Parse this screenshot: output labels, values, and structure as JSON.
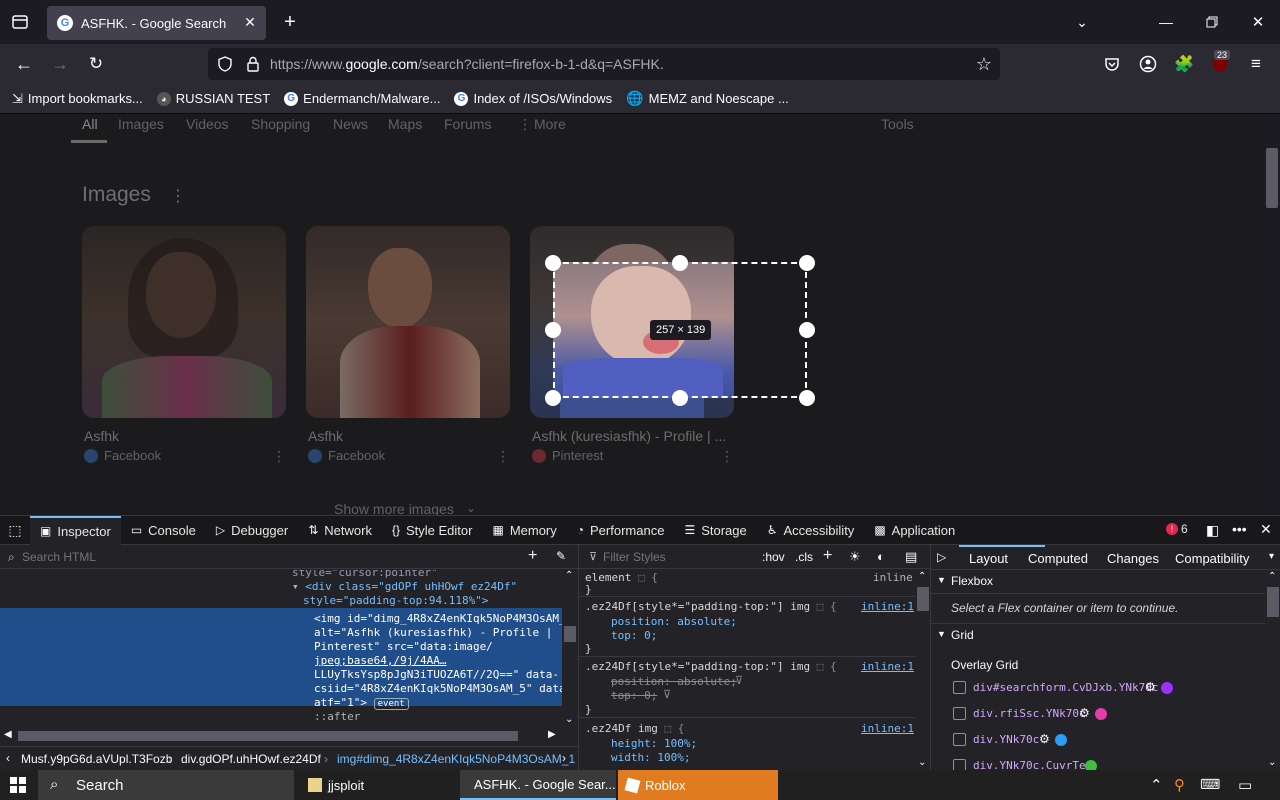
{
  "browser": {
    "tab_title": "ASFHK. - Google Search",
    "new_tab": "+",
    "url_prefix": "https://www.",
    "url_domain": "google.com",
    "url_rest": "/search?client=firefox-b-1-d&q=ASFHK.",
    "extension_badge": "23"
  },
  "bookmarks": [
    {
      "label": "Import bookmarks..."
    },
    {
      "label": "RUSSIAN TEST"
    },
    {
      "label": "Endermanch/Malware..."
    },
    {
      "label": "Index of /ISOs/Windows"
    },
    {
      "label": "MEMZ and Noescape ..."
    }
  ],
  "google": {
    "tabs": [
      "All",
      "Images",
      "Videos",
      "Shopping",
      "News",
      "Maps",
      "Forums",
      "More"
    ],
    "tools": "Tools",
    "section_title": "Images",
    "cards": [
      {
        "title": "Asfhk",
        "source": "Facebook"
      },
      {
        "title": "Asfhk",
        "source": "Facebook"
      },
      {
        "title": "Asfhk (kuresiasfhk) - Profile | ...",
        "source": "Pinterest"
      }
    ],
    "show_more": "Show more images",
    "size_tooltip": "257 × 139"
  },
  "devtools": {
    "tabs": [
      "Inspector",
      "Console",
      "Debugger",
      "Network",
      "Style Editor",
      "Memory",
      "Performance",
      "Storage",
      "Accessibility",
      "Application"
    ],
    "error_count": "6",
    "search_placeholder": "Search HTML",
    "filter_placeholder": "Filter Styles",
    "hov": ":hov",
    "cls": ".cls",
    "html_lines": {
      "line0": "style=\"cursor:pointer\"",
      "line1": "<div class=\"gdOPf uhHOwf ez24Df\"",
      "line2": "style=\"padding-top:94.118%\">",
      "line3": "<img id=\"dimg_4R8xZ4enKIqk5NoP4M3OsAM_1\"",
      "line4": "alt=\"Asfhk (kuresiasfhk) - Profile |",
      "line5": "Pinterest\" src=\"data:image/",
      "line6": "jpeg;base64,/9j/4AA…",
      "line7": "LLUyTksYsp8pJgN3iTUOZA6T//2Q==\" data-",
      "line8": "csiid=\"4R8xZ4enKIqk5NoP4M3OsAM_5\" data-",
      "line9": "atf=\"1\">",
      "event": "event",
      "after": "::after"
    },
    "breadcrumbs": [
      "Musf.y9pG6d.aVUpl.T3Fozb",
      "div.gdOPf.uhHOwf.ez24Df",
      "img#dimg_4R8xZ4enKIqk5NoP4M3OsAM_1"
    ],
    "rules": {
      "r1_selector": "element",
      "r1_source": "inline",
      "r2_selector": ".ez24Df[style*=\"padding-top:\"] img",
      "r2_source": "inline:1",
      "r2_p1": "position: absolute;",
      "r2_p2": "top: 0;",
      "r3_selector": ".ez24Df[style*=\"padding-top:\"] img",
      "r3_source": "inline:1",
      "r3_p1": "position: absolute;",
      "r3_p2": "top: 0;",
      "r4_selector": ".ez24Df img",
      "r4_source": "inline:1",
      "r4_p1": "height: 100%;",
      "r4_p2": "width: 100%;"
    },
    "layout_tabs": [
      "Layout",
      "Computed",
      "Changes",
      "Compatibility"
    ],
    "flexbox_title": "Flexbox",
    "flexbox_hint": "Select a Flex container or item to continue.",
    "grid_title": "Grid",
    "overlay_grid": "Overlay Grid",
    "grid_items": [
      {
        "label": "div#searchform.CvDJxb.YNk70c",
        "color": "#9b30ff"
      },
      {
        "label": "div.rfiSsc.YNk70c",
        "color": "#e63ca8"
      },
      {
        "label": "div.YNk70c",
        "color": "#2a9df4"
      },
      {
        "label": "div.YNk70c.CuvrTe",
        "color": "#3fbf3f"
      }
    ]
  },
  "taskbar": {
    "search": "Search",
    "items": [
      "jjsploit",
      "ASFHK. - Google Sear...",
      "Roblox"
    ]
  },
  "colors": {
    "accent": "#75bfff",
    "selection": "#204e8a",
    "roblox": "#e07b1f"
  }
}
